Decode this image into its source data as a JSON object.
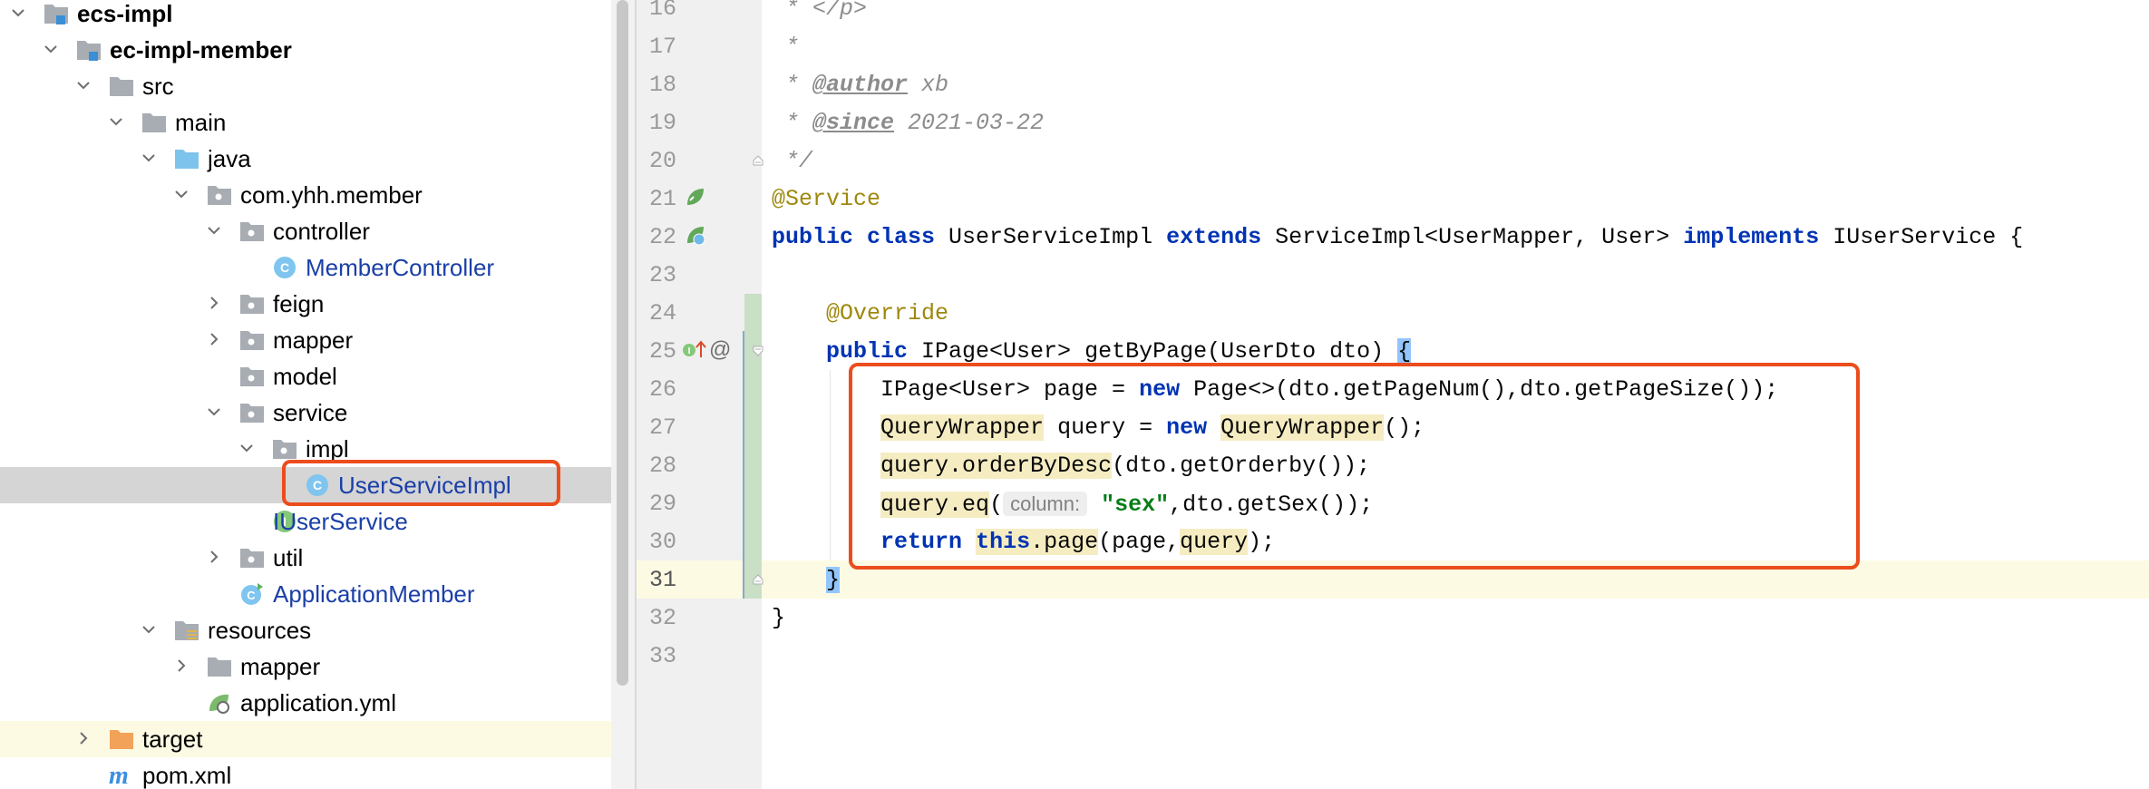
{
  "project_tree": {
    "items": [
      {
        "label": "ecs-impl",
        "bold": true
      },
      {
        "label": "ec-impl-member",
        "bold": true
      },
      {
        "label": "src"
      },
      {
        "label": "main"
      },
      {
        "label": "java"
      },
      {
        "label": "com.yhh.member"
      },
      {
        "label": "controller"
      },
      {
        "label": "MemberController"
      },
      {
        "label": "feign"
      },
      {
        "label": "mapper"
      },
      {
        "label": "model"
      },
      {
        "label": "service"
      },
      {
        "label": "impl"
      },
      {
        "label": "UserServiceImpl"
      },
      {
        "label": "IUserService"
      },
      {
        "label": "util"
      },
      {
        "label": "ApplicationMember"
      },
      {
        "label": "resources"
      },
      {
        "label": "mapper"
      },
      {
        "label": "application.yml"
      },
      {
        "label": "target"
      },
      {
        "label": "pom.xml"
      }
    ],
    "selected": "UserServiceImpl"
  },
  "editor": {
    "line_numbers": [
      "16",
      "17",
      "18",
      "19",
      "20",
      "21",
      "22",
      "23",
      "24",
      "25",
      "26",
      "27",
      "28",
      "29",
      "30",
      "31",
      "32",
      "33"
    ],
    "current_line": "31",
    "code": {
      "l16": {
        "a": " * ",
        "b": "</p>"
      },
      "l17": {
        "a": " *"
      },
      "l18": {
        "a": " * ",
        "tag": "@author",
        "b": " xb"
      },
      "l19": {
        "a": " * ",
        "tag": "@since",
        "b": " 2021-03-22"
      },
      "l20": {
        "a": " */"
      },
      "l21": {
        "a": "@Service"
      },
      "l22": {
        "k1": "public",
        "s1": " ",
        "k2": "class",
        "s2": " UserServiceImpl ",
        "k3": "extends",
        "s3": " ServiceImpl<UserMapper, User> ",
        "k4": "implements",
        "s4": " IUserService {"
      },
      "l24": {
        "a": "    @Override"
      },
      "l25": {
        "a": "    ",
        "k1": "public",
        "b": " IPage<User> getByPage(UserDto dto) ",
        "c": "{"
      },
      "l26": {
        "a": "        IPage<User> page = ",
        "k1": "new",
        "b": " Page<>(dto.getPageNum(),dto.getPageSize());"
      },
      "l27": {
        "a": "        ",
        "h1": "QueryWrapper",
        "b": " query = ",
        "k1": "new",
        "s": " ",
        "h2": "QueryWrapper",
        "c": "();"
      },
      "l28": {
        "a": "        ",
        "h1": "query.orderByDesc",
        "b": "(dto.getOrderby());"
      },
      "l29": {
        "a": "        ",
        "h1": "query.eq",
        "b": "(",
        "hint": "column:",
        "s": " ",
        "str": "\"sex\"",
        "c": ",dto.getSex());"
      },
      "l30": {
        "a": "        ",
        "k1": "return",
        "s": " ",
        "k2": "this",
        "b": ".",
        "h1": "page",
        "c": "(page,",
        "h2": "query",
        "d": ");"
      },
      "l31": {
        "a": "    ",
        "c": "}"
      },
      "l32": {
        "a": "}"
      }
    }
  },
  "colors": {
    "keyword": "#0033b3",
    "annotation": "#9e880d",
    "string": "#067d17",
    "comment": "#8c8c8c",
    "highlight_box": "#ec4d1d",
    "class_link": "#1a3fa8"
  }
}
